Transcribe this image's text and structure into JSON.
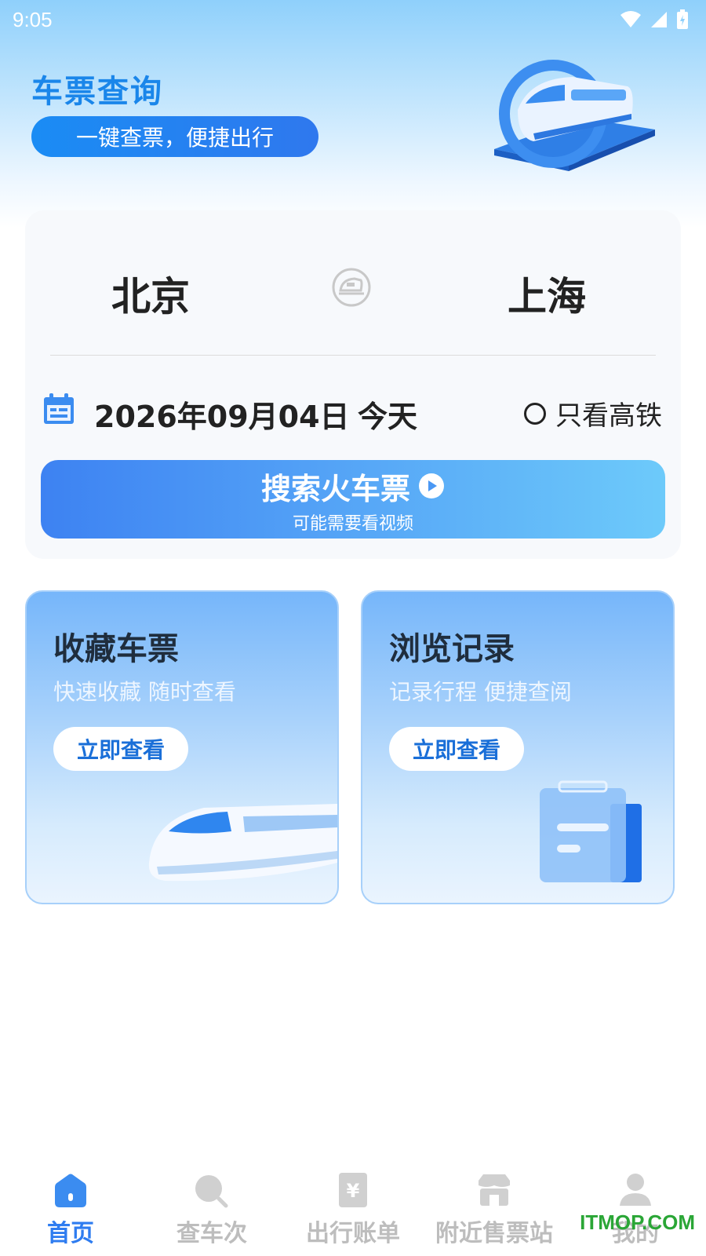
{
  "status_bar": {
    "time": "9:05"
  },
  "header": {
    "title": "车票查询",
    "slogan": "一键查票，便捷出行"
  },
  "search": {
    "from_city": "北京",
    "to_city": "上海",
    "date": "2026年09月04日",
    "day_label": "今天",
    "hsr_only_label": "只看高铁",
    "hsr_only_checked": false,
    "search_button_label": "搜索火车票",
    "search_button_sublabel": "可能需要看视频"
  },
  "features": [
    {
      "title": "收藏车票",
      "subtitle": "快速收藏 随时查看",
      "button": "立即查看"
    },
    {
      "title": "浏览记录",
      "subtitle": "记录行程 便捷查阅",
      "button": "立即查看"
    }
  ],
  "tabbar": {
    "active": "首页",
    "items": [
      {
        "label": "首页",
        "icon": "home-icon"
      },
      {
        "label": "查车次",
        "icon": "search-icon"
      },
      {
        "label": "出行账单",
        "icon": "bill-icon"
      },
      {
        "label": "附近售票站",
        "icon": "store-icon"
      },
      {
        "label": "我的",
        "icon": "profile-icon"
      }
    ]
  },
  "watermark": "ITMOP.COM",
  "colors": {
    "accent": "#2e7cf0",
    "title_blue": "#1a86ea",
    "inactive_tab": "#bdbdbd"
  }
}
